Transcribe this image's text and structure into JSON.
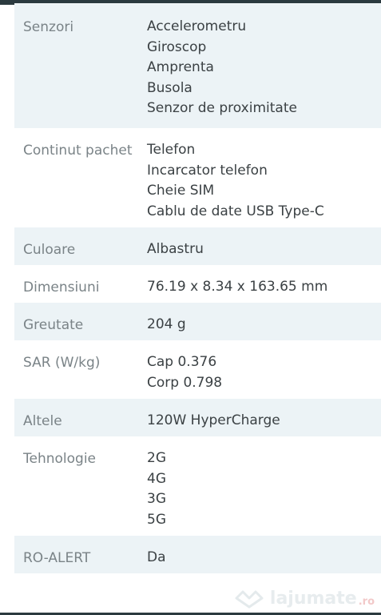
{
  "specs": [
    {
      "label": "Senzori",
      "values": [
        "Accelerometru",
        "Giroscop",
        "Amprenta",
        "Busola",
        "Senzor de proximitate"
      ]
    },
    {
      "label": "Continut pachet",
      "values": [
        "Telefon",
        "Incarcator telefon",
        "Cheie SIM",
        "Cablu de date USB Type-C"
      ]
    },
    {
      "label": "Culoare",
      "values": [
        "Albastru"
      ]
    },
    {
      "label": "Dimensiuni",
      "values": [
        "76.19 x 8.34 x 163.65 mm"
      ]
    },
    {
      "label": "Greutate",
      "values": [
        "204 g"
      ]
    },
    {
      "label": "SAR (W/kg)",
      "values": [
        "Cap 0.376",
        "Corp 0.798"
      ]
    },
    {
      "label": "Altele",
      "values": [
        "120W HyperCharge"
      ]
    },
    {
      "label": "Tehnologie",
      "values": [
        "2G",
        "4G",
        "3G",
        "5G"
      ]
    },
    {
      "label": "RO-ALERT",
      "values": [
        "Da"
      ]
    }
  ],
  "watermark": {
    "brand": "lajumate",
    "tld": ".ro",
    "icon": "lajumate-logo-icon"
  },
  "colors": {
    "shaded_row": "#ecf3f6",
    "label_text": "#7a8387",
    "value_text": "#3b4144"
  }
}
